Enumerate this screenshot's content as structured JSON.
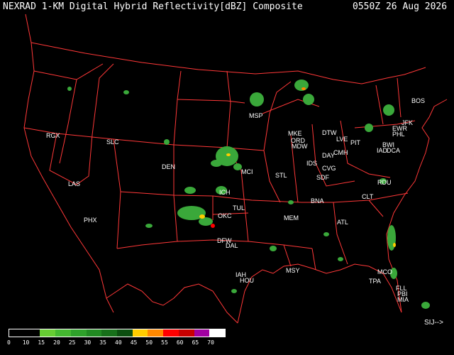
{
  "header": {
    "product_title": "NEXRAD 1-KM Digital Hybrid Reflectivity[dBZ] Composite",
    "timestamp": "0550Z 26 Aug 2026"
  },
  "legend": {
    "labels": [
      "0",
      "10",
      "15",
      "20",
      "25",
      "30",
      "35",
      "40",
      "45",
      "50",
      "55",
      "60",
      "65",
      "70"
    ],
    "colors": [
      "#000000",
      "#000000",
      "#66cc33",
      "#44b830",
      "#2ea12a",
      "#218a22",
      "#17701a",
      "#0c4f10",
      "#ffcc00",
      "#ff8800",
      "#ff0000",
      "#c80000",
      "#a000a0",
      "#ffffff"
    ]
  },
  "attribution": "SIJ-->",
  "cities": [
    {
      "id": "rgx",
      "label": "RGX"
    },
    {
      "id": "slc",
      "label": "SLC"
    },
    {
      "id": "den",
      "label": "DEN"
    },
    {
      "id": "las",
      "label": "LAS"
    },
    {
      "id": "phx",
      "label": "PHX"
    },
    {
      "id": "msp",
      "label": "MSP"
    },
    {
      "id": "mke",
      "label": "MKE"
    },
    {
      "id": "ord",
      "label": "ORD"
    },
    {
      "id": "mdw",
      "label": "MDW"
    },
    {
      "id": "dtw",
      "label": "DTW"
    },
    {
      "id": "lve",
      "label": "LVE"
    },
    {
      "id": "pit",
      "label": "PIT"
    },
    {
      "id": "bos",
      "label": "BOS"
    },
    {
      "id": "jfk",
      "label": "JFK"
    },
    {
      "id": "ewr",
      "label": "EWR"
    },
    {
      "id": "phl",
      "label": "PHL"
    },
    {
      "id": "bwi",
      "label": "BWI"
    },
    {
      "id": "iad",
      "label": "IAD"
    },
    {
      "id": "dca",
      "label": "DCA"
    },
    {
      "id": "day",
      "label": "DAY"
    },
    {
      "id": "cmh",
      "label": "CMH"
    },
    {
      "id": "cvg",
      "label": "CVG"
    },
    {
      "id": "ids",
      "label": "IDS"
    },
    {
      "id": "sdf",
      "label": "SDF"
    },
    {
      "id": "mci",
      "label": "MCI"
    },
    {
      "id": "stl",
      "label": "STL"
    },
    {
      "id": "ich",
      "label": "ICH"
    },
    {
      "id": "bna",
      "label": "BNA"
    },
    {
      "id": "clt",
      "label": "CLT"
    },
    {
      "id": "rdu",
      "label": "RDU"
    },
    {
      "id": "tul",
      "label": "TUL"
    },
    {
      "id": "okc",
      "label": "OKC"
    },
    {
      "id": "mem",
      "label": "MEM"
    },
    {
      "id": "atl",
      "label": "ATL"
    },
    {
      "id": "dfw",
      "label": "DFW"
    },
    {
      "id": "dal",
      "label": "DAL"
    },
    {
      "id": "iah",
      "label": "IAH"
    },
    {
      "id": "hou",
      "label": "HOU"
    },
    {
      "id": "msy",
      "label": "MSY"
    },
    {
      "id": "mco",
      "label": "MCO"
    },
    {
      "id": "tpa",
      "label": "TPA"
    },
    {
      "id": "fll",
      "label": "FLL"
    },
    {
      "id": "pbi",
      "label": "PBI"
    },
    {
      "id": "mia",
      "label": "MIA"
    }
  ]
}
